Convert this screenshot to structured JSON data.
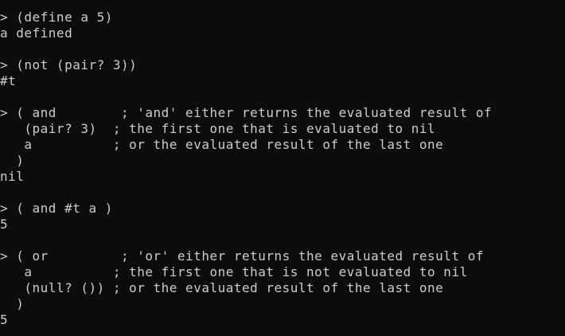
{
  "terminal": {
    "lines": [
      "> (define a 5)",
      "a defined",
      "",
      "> (not (pair? 3))",
      "#t",
      "",
      "> ( and        ; 'and' either returns the evaluated result of",
      "   (pair? 3)  ; the first one that is evaluated to nil",
      "   a          ; or the evaluated result of the last one",
      "  )",
      "nil",
      "",
      "> ( and #t a )",
      "5",
      "",
      "> ( or         ; 'or' either returns the evaluated result of",
      "   a          ; the first one that is not evaluated to nil",
      "   (null? ()) ; or the evaluated result of the last one",
      "  )",
      "5"
    ]
  }
}
